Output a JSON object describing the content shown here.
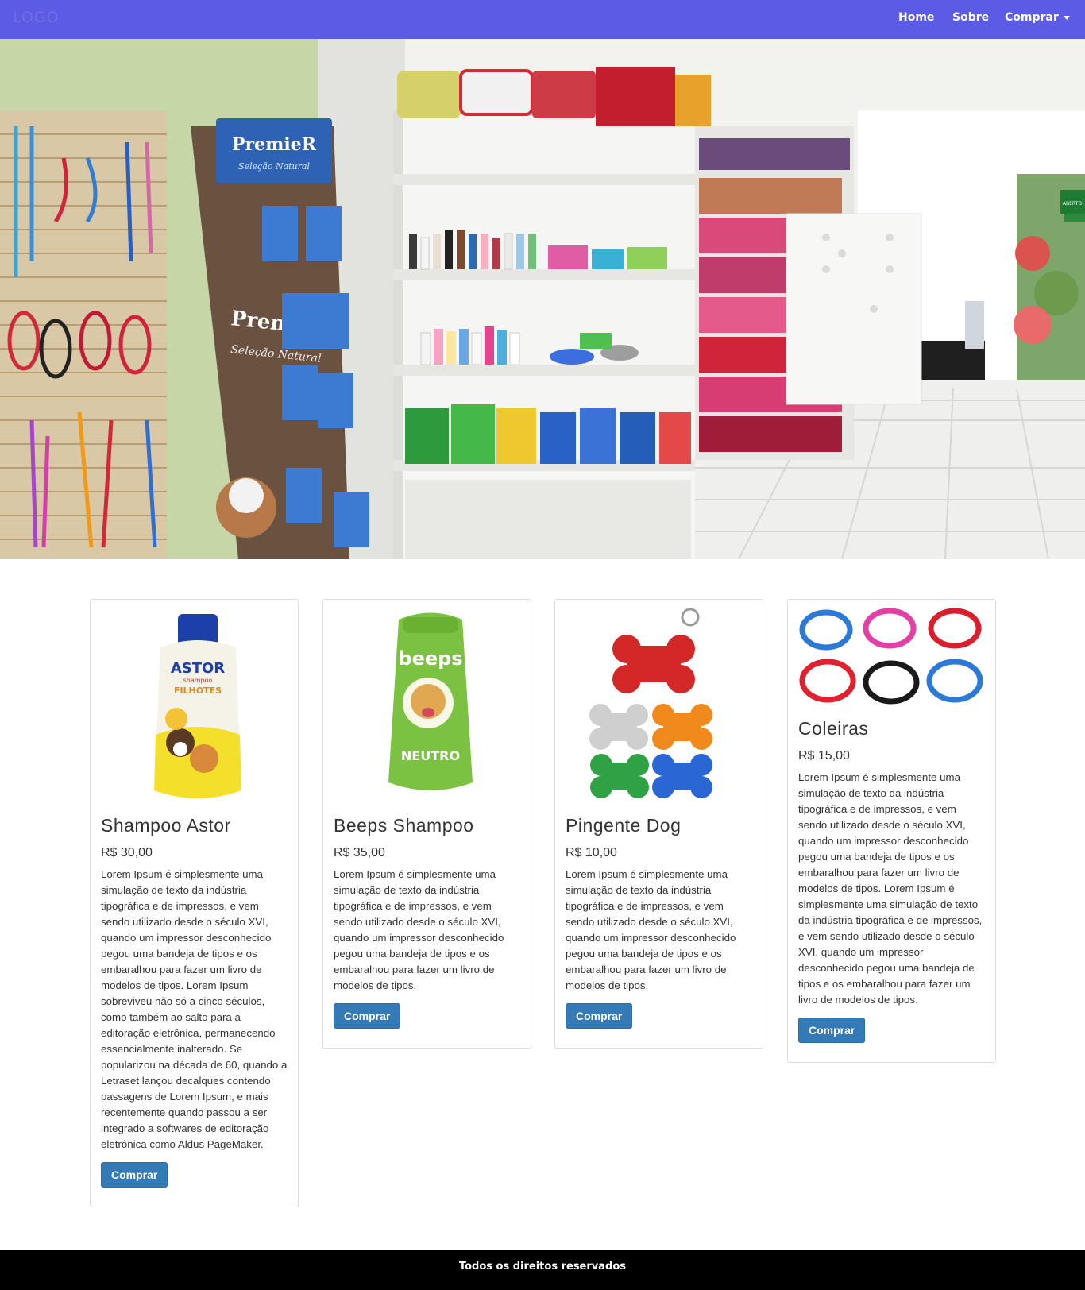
{
  "navbar": {
    "logo": "LOGO",
    "links": [
      {
        "label": "Home"
      },
      {
        "label": "Sobre"
      },
      {
        "label": "Comprar"
      }
    ]
  },
  "hero": {
    "signs": [
      "PremieR",
      "Seleção Natural",
      "PremieR",
      "Seleção Natural",
      "ABERTO"
    ]
  },
  "products": [
    {
      "title": "Shampoo Astor",
      "price": "R$ 30,00",
      "description": "Lorem Ipsum é simplesmente uma simulação de texto da indústria tipográfica e de impressos, e vem sendo utilizado desde o século XVI, quando um impressor desconhecido pegou uma bandeja de tipos e os embaralhou para fazer um livro de modelos de tipos. Lorem Ipsum sobreviveu não só a cinco séculos, como também ao salto para a editoração eletrônica, permanecendo essencialmente inalterado. Se popularizou na década de 60, quando a Letraset lançou decalques contendo passagens de Lorem Ipsum, e mais recentemente quando passou a ser integrado a softwares de editoração eletrônica como Aldus PageMaker.",
      "button": "Comprar",
      "image_text": [
        "ASTOR",
        "shampoo",
        "FILHOTES"
      ]
    },
    {
      "title": "Beeps Shampoo",
      "price": "R$ 35,00",
      "description": "Lorem Ipsum é simplesmente uma simulação de texto da indústria tipográfica e de impressos, e vem sendo utilizado desde o século XVI, quando um impressor desconhecido pegou uma bandeja de tipos e os embaralhou para fazer um livro de modelos de tipos.",
      "button": "Comprar",
      "image_text": [
        "beeps",
        "NEUTRO"
      ]
    },
    {
      "title": "Pingente Dog",
      "price": "R$ 10,00",
      "description": "Lorem Ipsum é simplesmente uma simulação de texto da indústria tipográfica e de impressos, e vem sendo utilizado desde o século XVI, quando um impressor desconhecido pegou uma bandeja de tipos e os embaralhou para fazer um livro de modelos de tipos.",
      "button": "Comprar"
    },
    {
      "title": "Coleiras",
      "price": "R$ 15,00",
      "description": "Lorem Ipsum é simplesmente uma simulação de texto da indústria tipográfica e de impressos, e vem sendo utilizado desde o século XVI, quando um impressor desconhecido pegou uma bandeja de tipos e os embaralhou para fazer um livro de modelos de tipos. Lorem Ipsum é simplesmente uma simulação de texto da indústria tipográfica e de impressos, e vem sendo utilizado desde o século XVI, quando um impressor desconhecido pegou uma bandeja de tipos e os embaralhou para fazer um livro de modelos de tipos.",
      "button": "Comprar"
    }
  ],
  "footer": {
    "text": "Todos os direitos reservados"
  },
  "colors": {
    "navbar": "#5b5be6",
    "button": "#337ab7",
    "footer": "#000000"
  }
}
